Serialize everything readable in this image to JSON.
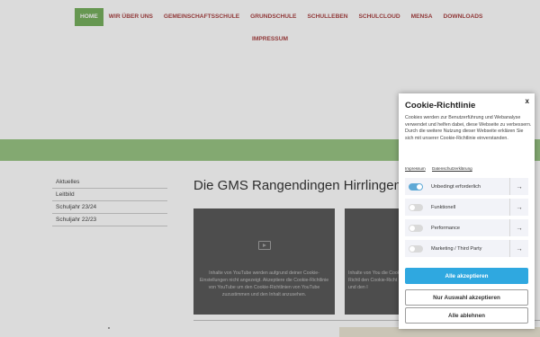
{
  "nav": {
    "items": [
      "HOME",
      "WIR ÜBER UNS",
      "GEMEINSCHAFTSSCHULE",
      "GRUNDSCHULE",
      "SCHULLEBEN",
      "SCHULCLOUD",
      "MENSA",
      "DOWNLOADS"
    ],
    "second_row": "IMPRESSUM",
    "active": "HOME"
  },
  "sidebar": {
    "items": [
      "Aktuelles",
      "Leitbild",
      "Schuljahr 23/24",
      "Schuljahr 22/23"
    ]
  },
  "main": {
    "title": "Die GMS Rangendingen Hirrlingen",
    "video1_text": "Inhalte von YouTube werden aufgrund deiner Cookie-Einstellungen nicht angezeigt. Akzeptiere die Cookie-Richtlinie von YouTube um den Cookie-Richtlinien von YouTube zuzustimmen und den Inhalt anzusehen.",
    "video2_text": "Inhalte von You die Cookie-Richtl den Cookie-Richt und den I"
  },
  "cookie": {
    "title": "Cookie-Richtlinie",
    "close": "x",
    "description": "Cookies werden zur Benutzerführung und Webanalyse verwendet und helfen dabei, diese Webseite zu verbessern. Durch die weitere Nutzung dieser Webseite erklären Sie sich mit unserer Cookie-Richtlinie einverstanden.",
    "links": [
      "Impressum",
      "Datenschutzerklärung"
    ],
    "categories": [
      {
        "label": "Unbedingt erforderlich",
        "enabled": true
      },
      {
        "label": "Funktionell",
        "enabled": false
      },
      {
        "label": "Performance",
        "enabled": false
      },
      {
        "label": "Marketing / Third Party",
        "enabled": false
      }
    ],
    "arrow": "→",
    "buttons": {
      "accept_all": "Alle akzeptieren",
      "accept_selection": "Nur Auswahl akzeptieren",
      "reject_all": "Alle ablehnen"
    }
  },
  "colors": {
    "nav_active": "#6aa84f",
    "nav_text": "#a03030",
    "green_band": "#8fbf78",
    "primary_button": "#2fa8e0",
    "toggle_on": "#5fa9d6"
  }
}
